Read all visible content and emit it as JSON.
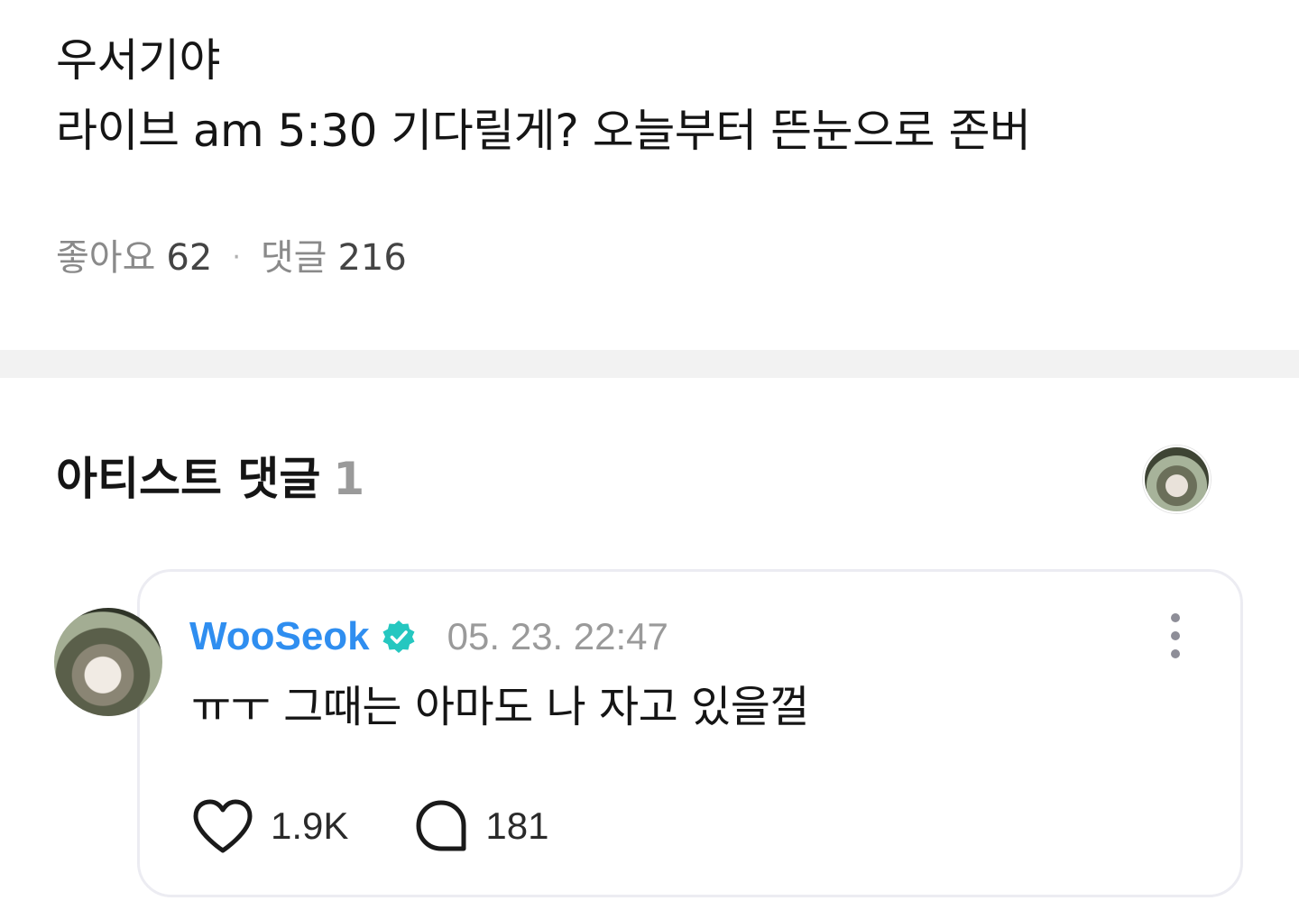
{
  "post": {
    "line1": "우서기야",
    "line2": "라이브 am 5:30 기다릴게? 오늘부터 뜬눈으로 존버",
    "likes_label": "좋아요",
    "likes_count": "62",
    "separator": "·",
    "comments_label": "댓글",
    "comments_count": "216"
  },
  "artist_section": {
    "title": "아티스트 댓글",
    "count": "1"
  },
  "comment": {
    "author": "WooSeok",
    "timestamp": "05. 23. 22:47",
    "text": "ㅠㅜ 그때는 아마도 나 자고 있을껄",
    "likes": "1.9K",
    "replies": "181"
  },
  "colors": {
    "author": "#2f8ef0",
    "verified": "#25c7c0",
    "muted": "#9a9a9a",
    "divider": "#f2f2f2"
  }
}
